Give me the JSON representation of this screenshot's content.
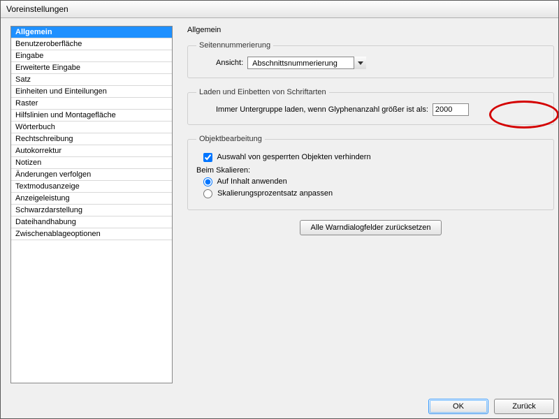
{
  "window": {
    "title": "Voreinstellungen"
  },
  "sidebar": {
    "items": [
      {
        "label": "Allgemein",
        "selected": true
      },
      {
        "label": "Benutzeroberfläche"
      },
      {
        "label": "Eingabe"
      },
      {
        "label": "Erweiterte Eingabe"
      },
      {
        "label": "Satz"
      },
      {
        "label": "Einheiten und Einteilungen"
      },
      {
        "label": "Raster"
      },
      {
        "label": "Hilfslinien und Montagefläche"
      },
      {
        "label": "Wörterbuch"
      },
      {
        "label": "Rechtschreibung"
      },
      {
        "label": "Autokorrektur"
      },
      {
        "label": "Notizen"
      },
      {
        "label": "Änderungen verfolgen"
      },
      {
        "label": "Textmodusanzeige"
      },
      {
        "label": "Anzeigeleistung"
      },
      {
        "label": "Schwarzdarstellung"
      },
      {
        "label": "Dateihandhabung"
      },
      {
        "label": "Zwischenablageoptionen"
      }
    ]
  },
  "main": {
    "title": "Allgemein",
    "page_numbering": {
      "legend": "Seitennummerierung",
      "view_label": "Ansicht:",
      "view_value": "Abschnittsnummerierung"
    },
    "fonts": {
      "legend": "Laden und Einbetten von Schriftarten",
      "subset_label": "Immer Untergruppe laden, wenn Glyphenanzahl größer ist als:",
      "subset_value": "2000"
    },
    "object_editing": {
      "legend": "Objektbearbeitung",
      "prevent_locked_label": "Auswahl von gesperrten Objekten verhindern",
      "prevent_locked_checked": true,
      "scaling_header": "Beim Skalieren:",
      "opt_content": "Auf Inhalt anwenden",
      "opt_percent": "Skalierungsprozentsatz anpassen",
      "scaling_selected": "content"
    },
    "reset_button": "Alle Warndialogfelder zurücksetzen"
  },
  "footer": {
    "ok": "OK",
    "cancel": "Zurück"
  }
}
